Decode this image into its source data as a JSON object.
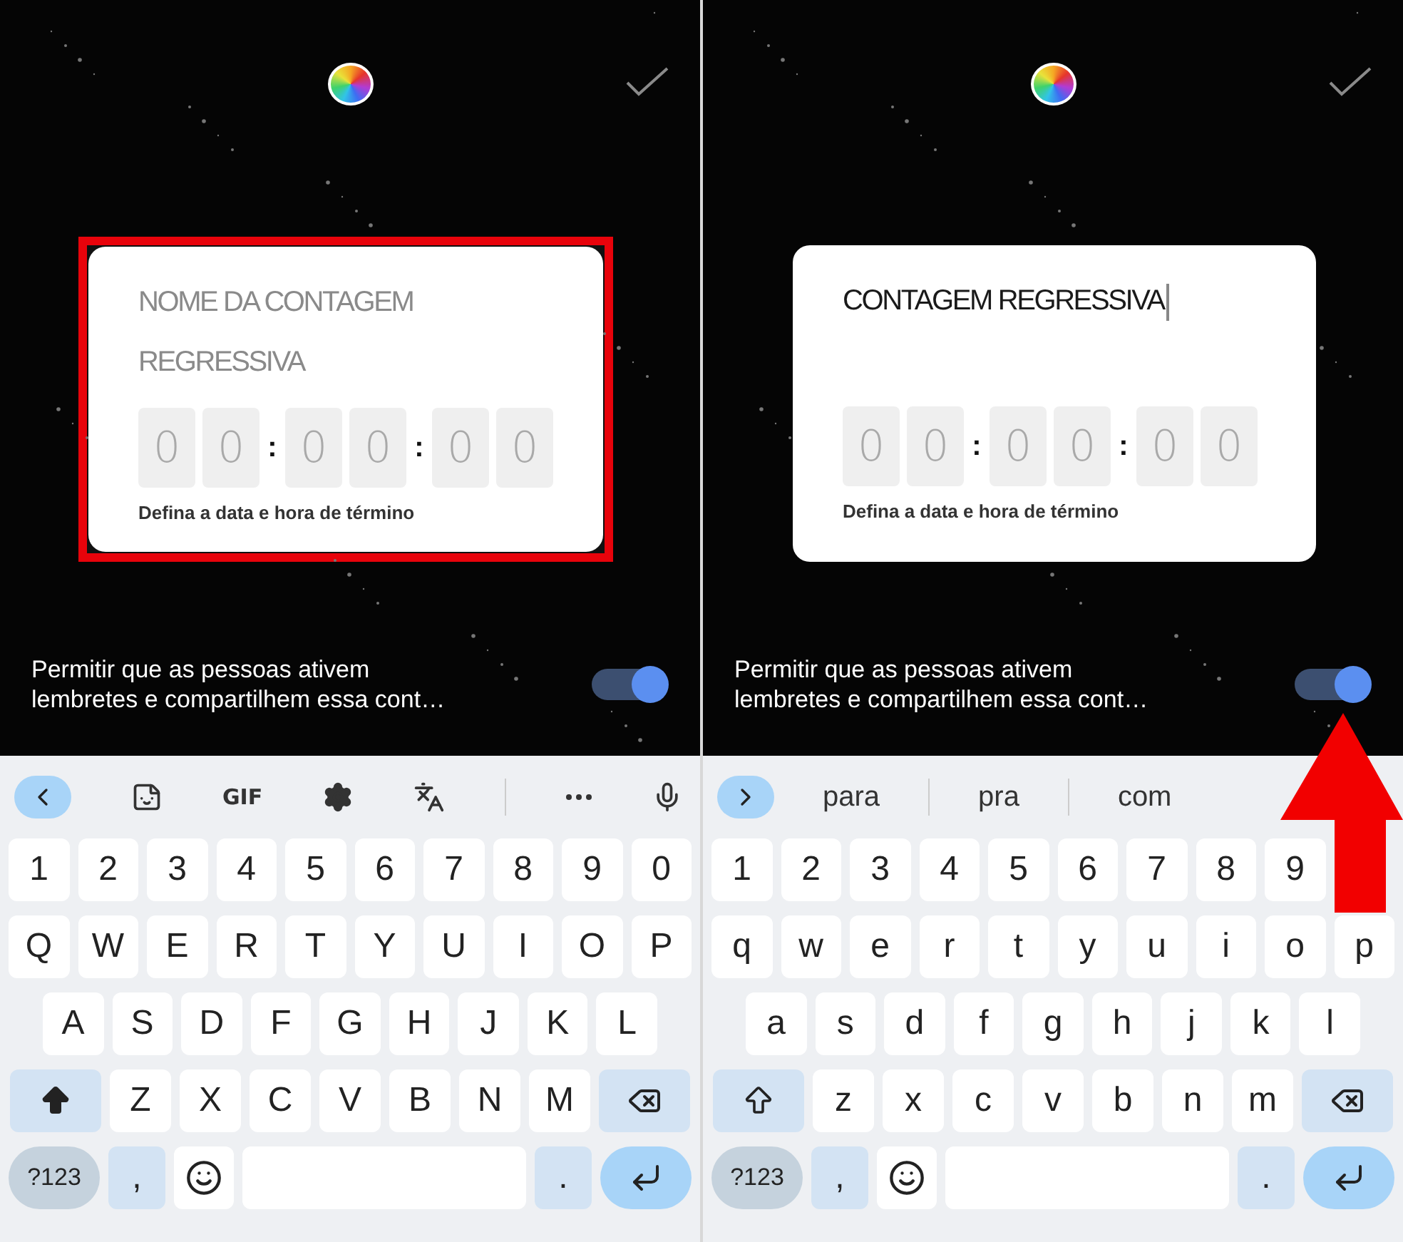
{
  "panels": [
    {
      "highlighted": true,
      "name_field": {
        "placeholder": "NOME DA CONTAGEM REGRESSIVA",
        "caret": false
      },
      "timer": [
        {
          "kind": "digit",
          "text": "0"
        },
        {
          "kind": "digit",
          "text": "0"
        },
        {
          "kind": "separator",
          "text": ":"
        },
        {
          "kind": "digit",
          "text": "0"
        },
        {
          "kind": "digit",
          "text": "0"
        },
        {
          "kind": "separator",
          "text": ":"
        },
        {
          "kind": "digit",
          "text": "0"
        },
        {
          "kind": "digit",
          "text": "0"
        }
      ],
      "hint": "Defina a data e hora de término",
      "toggle": {
        "label": "Permitir que as pessoas ativem lembretes e compartilhem essa cont…",
        "on": true
      },
      "keyboard": {
        "toolbar": {
          "kind": "tools",
          "gif_label": "GIF"
        },
        "shift_on": true,
        "key_rows": [
          [
            "1",
            "2",
            "3",
            "4",
            "5",
            "6",
            "7",
            "8",
            "9",
            "0"
          ],
          [
            "Q",
            "W",
            "E",
            "R",
            "T",
            "Y",
            "U",
            "I",
            "O",
            "P"
          ],
          [
            "A",
            "S",
            "D",
            "F",
            "G",
            "H",
            "J",
            "K",
            "L"
          ],
          [
            "Z",
            "X",
            "C",
            "V",
            "B",
            "N",
            "M"
          ]
        ],
        "symbols_key": "?123",
        "comma": ",",
        "period": "."
      }
    },
    {
      "name_field": {
        "value": "CONTAGEM REGRESSIVA",
        "caret": true
      },
      "timer": [
        {
          "kind": "digit",
          "text": "0"
        },
        {
          "kind": "digit",
          "text": "0"
        },
        {
          "kind": "separator",
          "text": ":"
        },
        {
          "kind": "digit",
          "text": "0"
        },
        {
          "kind": "digit",
          "text": "0"
        },
        {
          "kind": "separator",
          "text": ":"
        },
        {
          "kind": "digit",
          "text": "0"
        },
        {
          "kind": "digit",
          "text": "0"
        }
      ],
      "hint": "Defina a data e hora de término",
      "toggle": {
        "label": "Permitir que as pessoas ativem lembretes e compartilhem essa cont…",
        "on": true
      },
      "arrow": true,
      "keyboard": {
        "toolbar": {
          "kind": "suggestions",
          "suggestions": [
            "para",
            "pra",
            "com"
          ]
        },
        "shift_on": false,
        "key_rows": [
          [
            "1",
            "2",
            "3",
            "4",
            "5",
            "6",
            "7",
            "8",
            "9",
            null
          ],
          [
            "q",
            "w",
            "e",
            "r",
            "t",
            "y",
            "u",
            "i",
            "o",
            "p"
          ],
          [
            "a",
            "s",
            "d",
            "f",
            "g",
            "h",
            "j",
            "k",
            "l"
          ],
          [
            "z",
            "x",
            "c",
            "v",
            "b",
            "n",
            "m"
          ]
        ],
        "symbols_key": "?123",
        "comma": ",",
        "period": "."
      }
    }
  ]
}
